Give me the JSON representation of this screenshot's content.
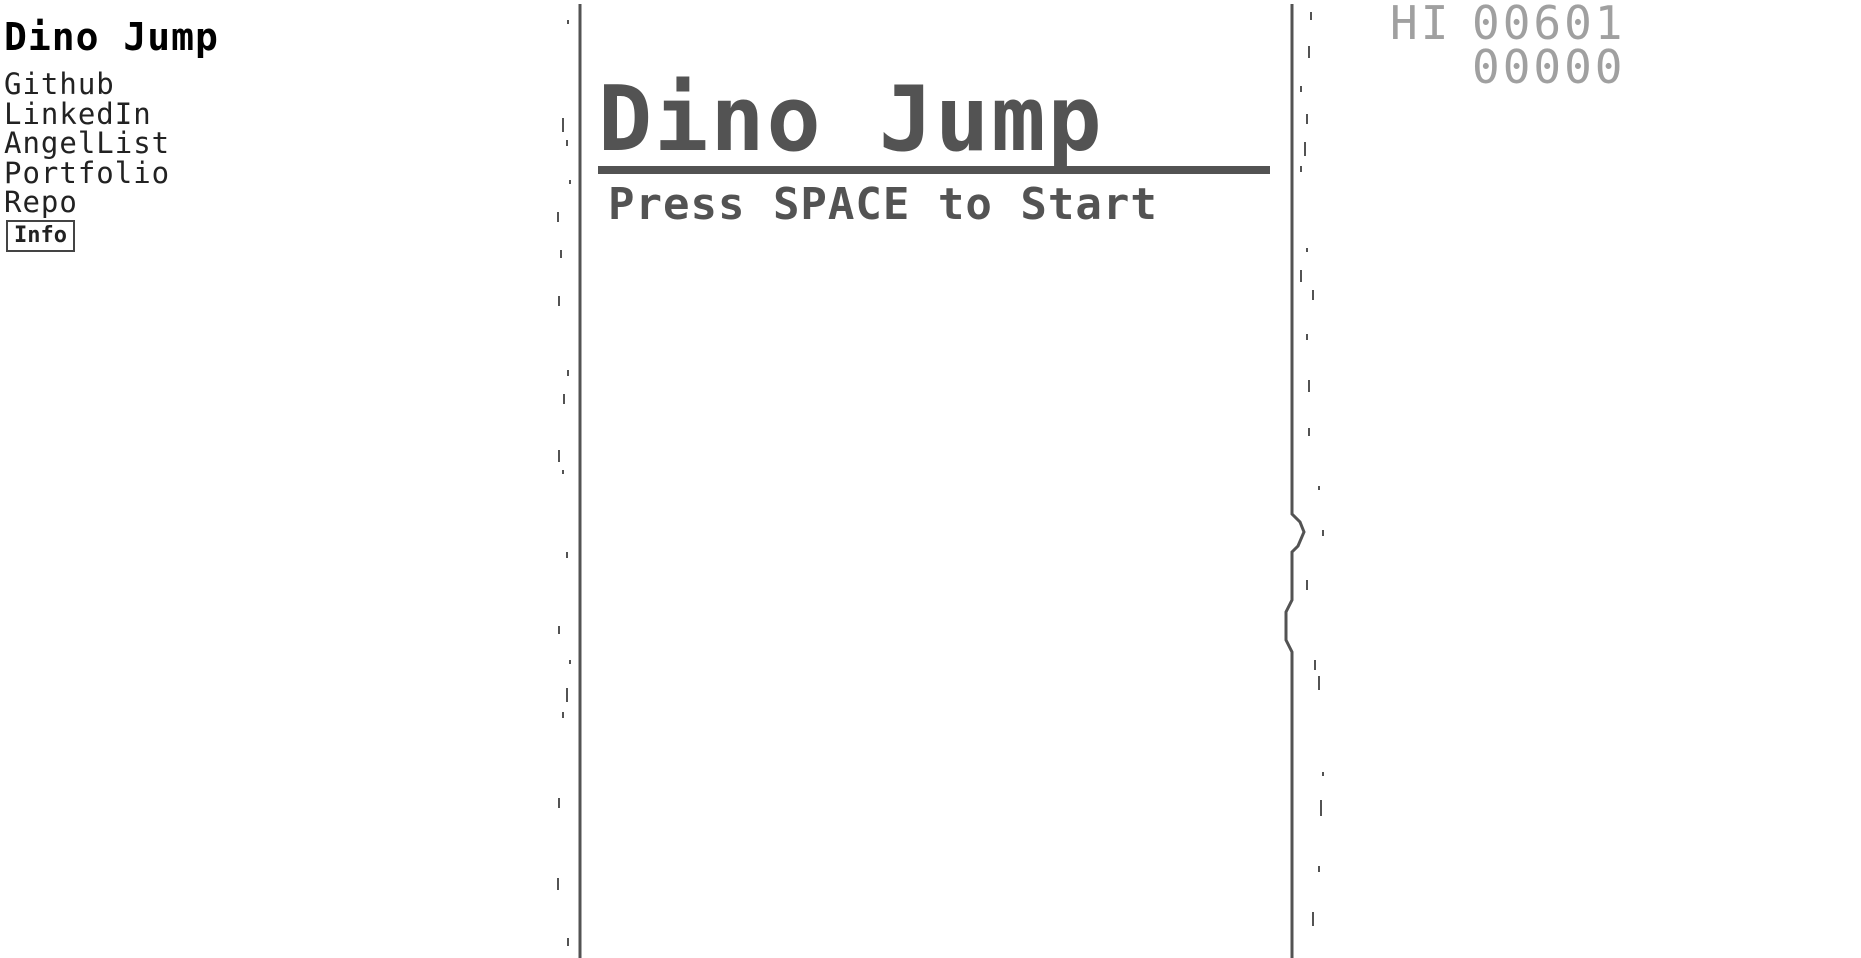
{
  "sidebar": {
    "title": "Dino Jump",
    "links": [
      "Github",
      "LinkedIn",
      "AngelList",
      "Portfolio",
      "Repo"
    ],
    "info_button": "Info"
  },
  "game": {
    "title": "Dino Jump",
    "prompt": "Press SPACE to Start",
    "hi_label": "HI",
    "hi_score": "00601",
    "current_score": "00000"
  },
  "colors": {
    "ink": "#535353",
    "score": "#a0a0a0",
    "background": "#ffffff"
  }
}
